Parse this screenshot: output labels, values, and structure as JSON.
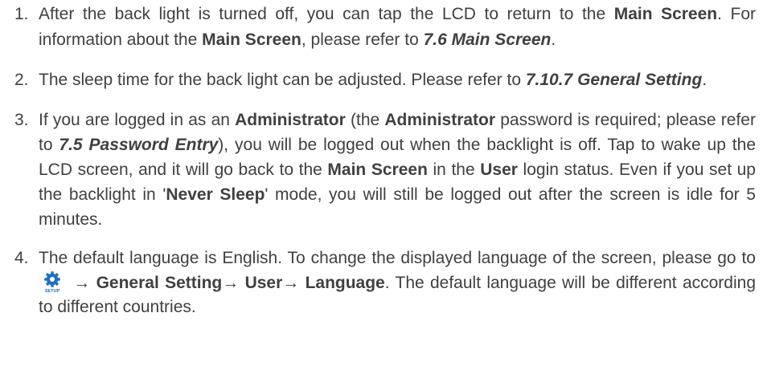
{
  "items": [
    {
      "number": "1.",
      "parts": [
        {
          "text": "After the back light is turned off, you can tap the LCD to return to the "
        },
        {
          "text": "Main Screen"
        },
        {
          "text": ". For information about the "
        },
        {
          "text": "Main Screen"
        },
        {
          "text": ", please refer to "
        },
        {
          "text": "7.6 Main Screen"
        },
        {
          "text": "."
        }
      ]
    },
    {
      "number": "2.",
      "parts": [
        {
          "text": "The sleep time for the back light can be adjusted. Please refer to "
        },
        {
          "text": "7.10.7 General Setting"
        },
        {
          "text": "."
        }
      ]
    },
    {
      "number": "3.",
      "parts": [
        {
          "text": "If you are logged in as an "
        },
        {
          "text": "Administrator"
        },
        {
          "text": " (the "
        },
        {
          "text": "Administrator"
        },
        {
          "text": " password is required; please refer to "
        },
        {
          "text": "7.5 Password Entry"
        },
        {
          "text": "), you will be logged out when the backlight is off. Tap to wake up the LCD screen, and it will go back to the "
        },
        {
          "text": "Main Screen"
        },
        {
          "text": " in the "
        },
        {
          "text": "User"
        },
        {
          "text": " login status. Even if you set up the backlight in '"
        },
        {
          "text": "Never Sleep"
        },
        {
          "text": "' mode, you will still be logged out after the screen is idle for 5 minutes."
        }
      ]
    },
    {
      "number": "4.",
      "parts": [
        {
          "text": "The default language is English. To change the displayed language of the screen, please go to "
        },
        {
          "text": " → "
        },
        {
          "text": "General Setting"
        },
        {
          "text": "→ "
        },
        {
          "text": "User"
        },
        {
          "text": "→ "
        },
        {
          "text": "Language"
        },
        {
          "text": ". The default language will be different according to different countries."
        }
      ],
      "icon": {
        "name": "setup-gear-icon",
        "label": "SETUP",
        "color": "#1f6fc0"
      }
    }
  ]
}
